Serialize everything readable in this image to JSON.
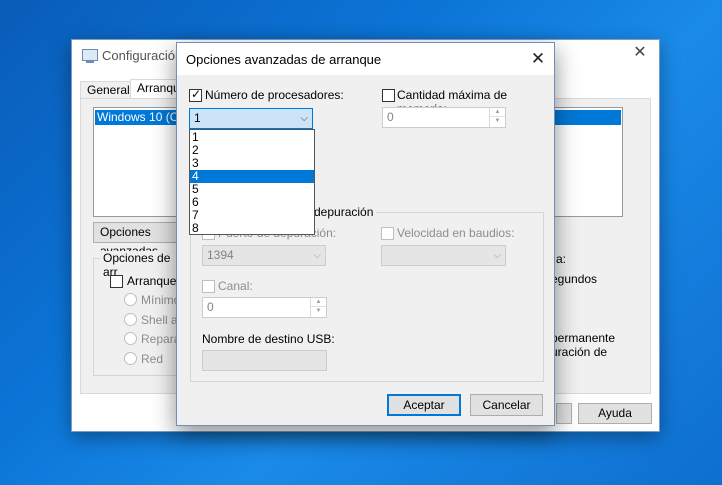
{
  "background_window": {
    "title": "Configuración",
    "tabs": [
      "General",
      "Arranque"
    ],
    "list_item": "Windows 10 (C:\\",
    "advanced_button": "Opciones avanzadas",
    "boot_options_label": "Opciones de arr",
    "safe_boot_label": "Arranque a",
    "radios": [
      "Mínimo",
      "Shell alt",
      "Reparar",
      "Red"
    ],
    "right_partial_1": "a:",
    "right_partial_2": "egundos",
    "right_partial_3": "permanente",
    "right_partial_4": "uración de",
    "help_button": "Ayuda"
  },
  "dialog": {
    "title": "Opciones avanzadas de arranque",
    "num_processors": {
      "label": "Número de procesadores:",
      "checked": true,
      "value": "1",
      "options": [
        "1",
        "2",
        "3",
        "4",
        "5",
        "6",
        "7",
        "8"
      ],
      "highlighted": "4"
    },
    "max_memory": {
      "label": "Cantidad máxima de memoria:",
      "checked": false,
      "value": "0"
    },
    "debug_group_label": "depuración",
    "debug_port": {
      "label": "Puerto de depuración:",
      "value": "1394"
    },
    "baud_rate": {
      "label": "Velocidad en baudios:",
      "value": ""
    },
    "channel": {
      "label": "Canal:",
      "value": "0"
    },
    "usb_target": {
      "label": "Nombre de destino USB:",
      "value": ""
    },
    "ok_button": "Aceptar",
    "cancel_button": "Cancelar"
  },
  "colors": {
    "accent": "#0078d7",
    "desktop": "#0b74d6"
  }
}
